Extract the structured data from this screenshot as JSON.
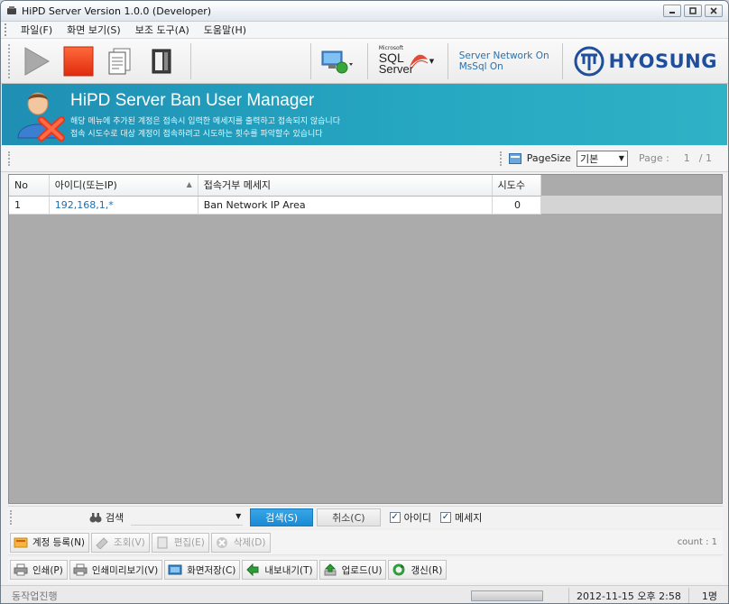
{
  "window": {
    "title": "HiPD Server Version 1.0.0 (Developer)"
  },
  "menu": [
    "파일(F)",
    "화면 보기(S)",
    "보조 도구(A)",
    "도움말(H)"
  ],
  "toolbar": {
    "sql_server_small": "Microsoft",
    "sql_server_big1": "SQL",
    "sql_server_big2": "Server",
    "server_status_line1": "Server Network On",
    "server_status_line2": "MsSql On",
    "brand": "HYOSUNG"
  },
  "banner": {
    "title": "HiPD Server Ban User Manager",
    "desc_line1": "해당 메뉴에 추가된 계정은 접속시 입력한 메세지를 출력하고 접속되지 않습니다",
    "desc_line2": "접속 시도수로 대상 계정이 접속하려고 시도하는 횟수를 파악할수 있습니다"
  },
  "pagebar": {
    "pagesize_label": "PageSize",
    "pagesize_value": "기본",
    "page_label": "Page :",
    "page_current": "1",
    "page_total": "/ 1"
  },
  "grid": {
    "columns": [
      "No",
      "아이디(또는IP)",
      "접속거부 메세지",
      "시도수"
    ],
    "rows": [
      {
        "no": "1",
        "id": "192,168,1,*",
        "message": "Ban Network IP Area",
        "attempts": "0"
      }
    ]
  },
  "search": {
    "label": "검색",
    "search_button": "검색(S)",
    "cancel_button": "취소(C)",
    "check_id": "아이디",
    "check_message": "메세지"
  },
  "actions_row1": {
    "register": "계정 등록(N)",
    "view": "조회(V)",
    "edit": "편집(E)",
    "delete": "삭제(D)",
    "count": "count : 1"
  },
  "actions_row2": {
    "print": "인쇄(P)",
    "print_preview": "인쇄미리보기(V)",
    "save_screen": "화면저장(C)",
    "export": "내보내기(T)",
    "upload": "업로드(U)",
    "refresh": "갱신(R)"
  },
  "statusbar": {
    "status": "동작업진행",
    "datetime": "2012-11-15 오후 2:58",
    "users": "1명"
  },
  "colors": {
    "banner": "#26a8c2",
    "brand": "#1f4e9c",
    "primary_button": "#1d8bd4"
  }
}
